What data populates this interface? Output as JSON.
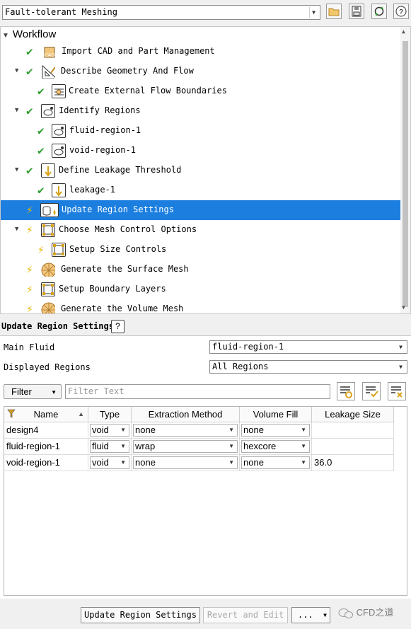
{
  "workflow_selector": {
    "value": "Fault-tolerant Meshing"
  },
  "tree": {
    "title": "Workflow",
    "items": [
      {
        "label": "Import CAD and Part Management",
        "status": "done",
        "icon": "cad-import-icon"
      },
      {
        "label": "Describe Geometry And Flow",
        "status": "done",
        "icon": "geometry-flow-icon"
      },
      {
        "label": "Create External Flow Boundaries",
        "status": "done",
        "icon": "flow-boundaries-icon"
      },
      {
        "label": "Identify Regions",
        "status": "done",
        "icon": "region-icon"
      },
      {
        "label": "fluid-region-1",
        "status": "done",
        "icon": "region-icon"
      },
      {
        "label": "void-region-1",
        "status": "done",
        "icon": "region-icon"
      },
      {
        "label": "Define Leakage Threshold",
        "status": "done",
        "icon": "leakage-icon"
      },
      {
        "label": "leakage-1",
        "status": "done",
        "icon": "leakage-icon"
      },
      {
        "label": "Update Region Settings",
        "status": "pending",
        "icon": "region-settings-icon"
      },
      {
        "label": "Choose Mesh Control Options",
        "status": "pending",
        "icon": "mesh-control-icon"
      },
      {
        "label": "Setup Size Controls",
        "status": "pending",
        "icon": "mesh-control-icon"
      },
      {
        "label": "Generate the Surface Mesh",
        "status": "pending",
        "icon": "surface-mesh-icon"
      },
      {
        "label": "Setup Boundary Layers",
        "status": "pending",
        "icon": "boundary-layer-icon"
      },
      {
        "label": "Generate the Volume Mesh",
        "status": "pending",
        "icon": "volume-mesh-icon"
      }
    ]
  },
  "panel": {
    "title": "Update Region Settings",
    "help_label": "?",
    "main_fluid_label": "Main Fluid",
    "main_fluid_value": "fluid-region-1",
    "displayed_regions_label": "Displayed Regions",
    "displayed_regions_value": "All Regions",
    "filter_label": "Filter",
    "filter_placeholder": "Filter Text",
    "table": {
      "columns": [
        "Name",
        "Type",
        "Extraction Method",
        "Volume Fill",
        "Leakage Size"
      ],
      "rows": [
        {
          "name": "design4",
          "type": "void",
          "extraction": "none",
          "fill": "none",
          "leakage": ""
        },
        {
          "name": "fluid-region-1",
          "type": "fluid",
          "extraction": "wrap",
          "fill": "hexcore",
          "leakage": ""
        },
        {
          "name": "void-region-1",
          "type": "void",
          "extraction": "none",
          "fill": "none",
          "leakage": "36.0"
        }
      ]
    }
  },
  "bottom": {
    "update_label": "Update Region Settings",
    "revert_label": "Revert and Edit",
    "more_label": "...",
    "watermark": "CFD之道"
  },
  "colors": {
    "selection": "#1c7fe0",
    "check": "#2e9e2e",
    "bolt": "#e6b800"
  }
}
